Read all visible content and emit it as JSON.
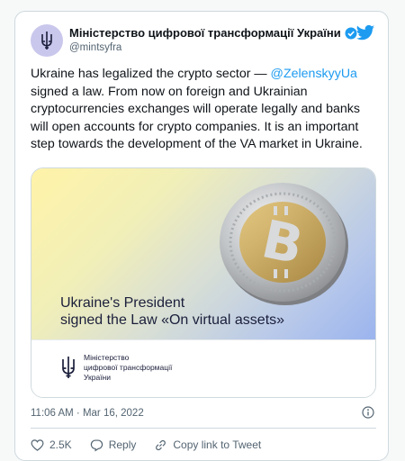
{
  "account": {
    "name": "Міністерство цифрової трансформації України",
    "handle": "@mintsyfra"
  },
  "tweet": {
    "text_before": "Ukraine has legalized the crypto sector — ",
    "mention": "@ZelenskyyUa",
    "text_after": " signed a law. From now on foreign and Ukrainian cryptocurrencies exchanges will operate legally and banks will open accounts for crypto companies. It is an important step towards the development of the VA market in Ukraine."
  },
  "media": {
    "headline_line1": "Ukraine's President",
    "headline_line2": "signed the Law «On virtual assets»",
    "ministry_line1": "Міністерство",
    "ministry_line2": "цифрової трансформації",
    "ministry_line3": "України"
  },
  "meta": {
    "timestamp": "11:06 AM · Mar 16, 2022"
  },
  "actions": {
    "likes": "2.5K",
    "reply": "Reply",
    "copy_link": "Copy link to Tweet"
  },
  "colors": {
    "accent": "#1d9bf0",
    "like_red": "#536471",
    "text": "#0f1419",
    "muted": "#536471"
  },
  "icons": [
    "trident-icon",
    "verified-badge-icon",
    "twitter-bird-icon",
    "bitcoin-coin-image",
    "info-icon",
    "heart-icon",
    "reply-icon",
    "link-icon"
  ]
}
